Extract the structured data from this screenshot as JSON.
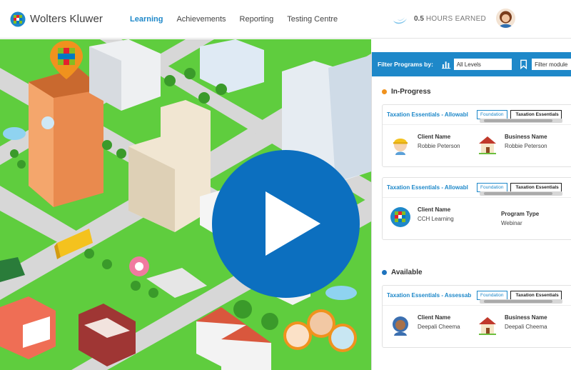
{
  "header": {
    "brand": "Wolters Kluwer",
    "nav": [
      "Learning",
      "Achievements",
      "Reporting",
      "Testing Centre"
    ],
    "hours_value": "0.5",
    "hours_label": "HOURS EARNED"
  },
  "filter": {
    "label": "Filter Programs by:",
    "level": "All Levels",
    "module": "Filter module"
  },
  "sections": {
    "in_progress": "In-Progress",
    "available": "Available"
  },
  "cards": [
    {
      "title": "Taxation Essentials - Allowabl",
      "tag1": "Foundation",
      "tag2": "Taxation Essentials",
      "left_label": "Client Name",
      "left_value": "Robbie Peterson",
      "right_label": "Business Name",
      "right_value": "Robbie Peterson"
    },
    {
      "title": "Taxation Essentials - Allowabl",
      "tag1": "Foundation",
      "tag2": "Taxation Essentials",
      "left_label": "Client Name",
      "left_value": "CCH Learning",
      "right_label": "Program Type",
      "right_value": "Webinar"
    },
    {
      "title": "Taxation Essentials - Assessab",
      "tag1": "Foundation",
      "tag2": "Taxation Essentials",
      "left_label": "Client Name",
      "left_value": "Deepali Cheema",
      "right_label": "Business Name",
      "right_value": "Deepali Cheema"
    }
  ],
  "colors": {
    "accent": "#1e88c9",
    "play": "#0c6fbf",
    "in_progress_dot": "#f0921e",
    "available_dot": "#1e73be",
    "grass": "#5fcd3e"
  },
  "icons": {
    "logo": "wolters-kluwer-logo",
    "hours": "water-drop-icon",
    "play": "play-icon",
    "chart": "bar-chart-icon",
    "bookmark": "bookmark-icon"
  }
}
